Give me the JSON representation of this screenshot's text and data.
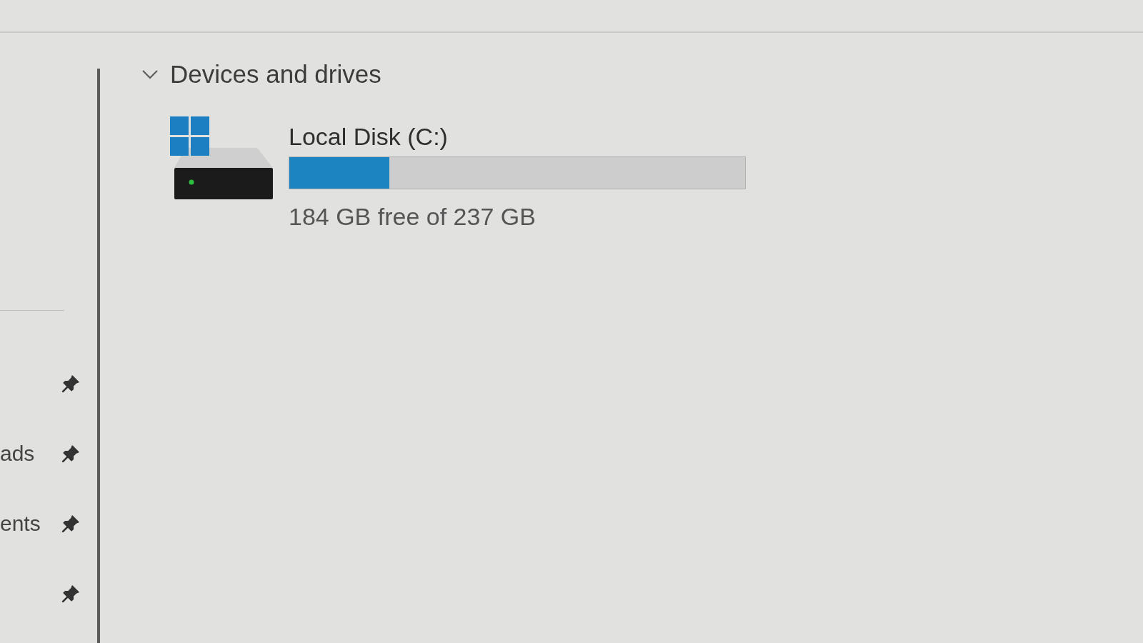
{
  "sidebar": {
    "items": [
      {
        "pinned": true
      },
      {
        "label": "ads",
        "pinned": true
      },
      {
        "label": "ents",
        "pinned": true
      },
      {
        "pinned": true
      }
    ]
  },
  "section": {
    "title": "Devices and drives",
    "expanded": true,
    "drives": [
      {
        "name": "Local Disk (C:)",
        "level": 0.22,
        "reading": "184 GB free of 237 GB"
      }
    ]
  }
}
